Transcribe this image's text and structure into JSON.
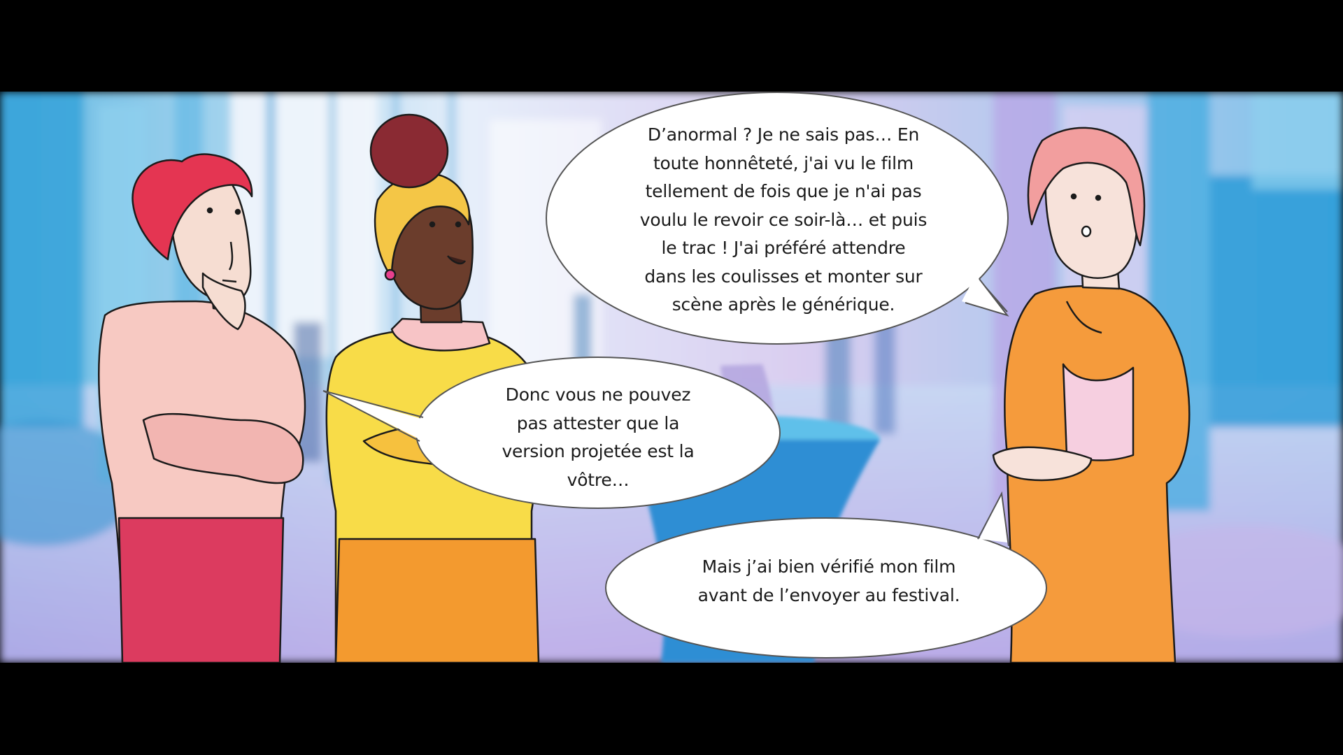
{
  "panel": {
    "speech_bubbles": [
      {
        "speaker": "right-woman",
        "lines": [
          "D’anormal ? Je ne sais pas…  En",
          "toute honnêteté, j'ai vu le film",
          "tellement de fois que je n'ai pas",
          "voulu le revoir ce soir-là… et puis",
          "le trac ! J'ai préféré attendre",
          "dans les coulisses et monter sur",
          "scène après le générique."
        ]
      },
      {
        "speaker": "left-man",
        "lines": [
          "Donc vous ne pouvez",
          "pas attester que la",
          "version projetée est la",
          "vôtre…"
        ]
      },
      {
        "speaker": "right-woman",
        "lines": [
          "Mais j’ai bien vérifié mon film",
          "avant de l’envoyer au festival."
        ]
      }
    ]
  },
  "colors": {
    "letterbox": "#000000",
    "background_blue": "#4fb0de",
    "background_lilac": "#c9b6e8",
    "man_shirt": "#f6c7c2",
    "man_pants": "#d9365a",
    "man_hair": "#e0334f",
    "woman_sweater": "#f7dc4a",
    "woman_pants": "#f29a2e",
    "right_woman_suit": "#f59a3c",
    "right_woman_hair": "#f29a9a",
    "table": "#3a9fd9"
  }
}
